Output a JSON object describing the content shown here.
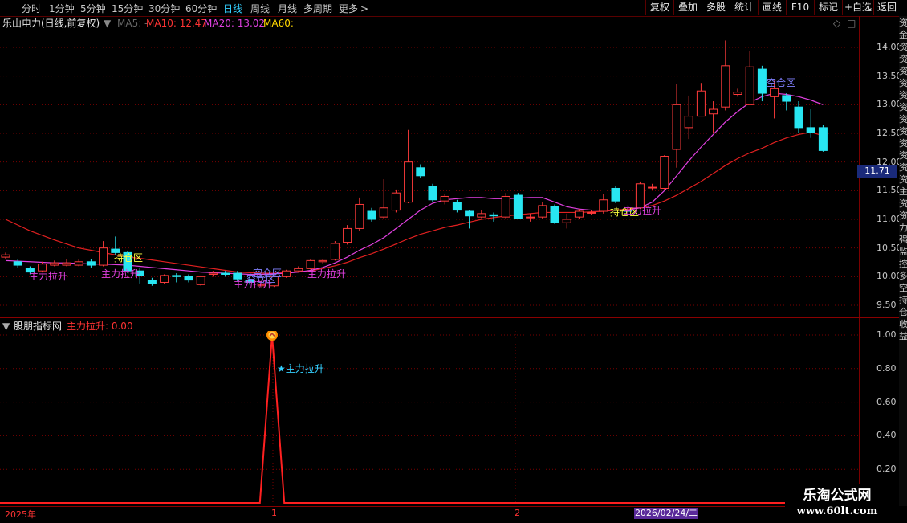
{
  "toolbar": {
    "periods": [
      "分时",
      "1分钟",
      "5分钟",
      "15分钟",
      "30分钟",
      "60分钟",
      "日线",
      "周线",
      "月线",
      "多周期",
      "更多"
    ],
    "active_period": "日线",
    "more_arrow": ">",
    "right_buttons": [
      "复权",
      "叠加",
      "多股",
      "统计",
      "画线",
      "F10",
      "标记",
      "+自选",
      "返回"
    ]
  },
  "main_info": {
    "stock_label": "乐山电力(日线,前复权)",
    "ma5": "MA5: -",
    "ma10": "MA10: 12.47",
    "ma20": "MA20: 13.02",
    "ma60": "MA60:"
  },
  "sub_info": {
    "title": "股朋指标网",
    "value": "主力拉升: 0.00"
  },
  "colors": {
    "up": "#ff3b3b",
    "down": "#28e6f2",
    "ma_red": "#e02020",
    "ma_purple": "#e040e0",
    "label_purple": "#e040e0",
    "label_blue": "#8080ff",
    "label_yellow": "#ffff40",
    "axis_text": "#c8c8c8",
    "grid": "#7a0000"
  },
  "price_axis": {
    "ticks": [
      "14.00",
      "13.50",
      "13.00",
      "12.50",
      "12.00",
      "11.50",
      "11.00",
      "10.50",
      "10.00",
      "9.50"
    ],
    "current_price": "11.71"
  },
  "sub_axis": {
    "ticks": [
      "1.00",
      "0.80",
      "0.60",
      "0.40",
      "0.20"
    ]
  },
  "time_axis": {
    "labels": [
      "2025年",
      "1",
      "2"
    ],
    "cursor_date": "2026/02/24/二"
  },
  "chart_data": [
    {
      "type": "candlestick",
      "title": "乐山电力(日线,前复权)",
      "ylim": [
        9.3,
        14.3
      ],
      "candles": [
        {
          "o": 10.34,
          "c": 10.38,
          "h": 10.42,
          "l": 10.3
        },
        {
          "o": 10.26,
          "c": 10.2,
          "h": 10.3,
          "l": 10.16
        },
        {
          "o": 10.14,
          "c": 10.08,
          "h": 10.18,
          "l": 10.04
        },
        {
          "o": 10.1,
          "c": 10.22,
          "h": 10.26,
          "l": 10.08
        },
        {
          "o": 10.2,
          "c": 10.24,
          "h": 10.28,
          "l": 10.18
        },
        {
          "o": 10.2,
          "c": 10.24,
          "h": 10.3,
          "l": 10.18
        },
        {
          "o": 10.2,
          "c": 10.26,
          "h": 10.3,
          "l": 10.18
        },
        {
          "o": 10.26,
          "c": 10.2,
          "h": 10.3,
          "l": 10.16
        },
        {
          "o": 10.2,
          "c": 10.5,
          "h": 10.62,
          "l": 10.18
        },
        {
          "o": 10.48,
          "c": 10.42,
          "h": 10.7,
          "l": 10.38
        },
        {
          "o": 10.42,
          "c": 10.1,
          "h": 10.45,
          "l": 10.06
        },
        {
          "o": 10.1,
          "c": 10.02,
          "h": 10.16,
          "l": 9.88
        },
        {
          "o": 9.94,
          "c": 9.88,
          "h": 9.98,
          "l": 9.84
        },
        {
          "o": 9.9,
          "c": 10.02,
          "h": 10.04,
          "l": 9.88
        },
        {
          "o": 10.02,
          "c": 10.0,
          "h": 10.06,
          "l": 9.9
        },
        {
          "o": 10.0,
          "c": 9.94,
          "h": 10.04,
          "l": 9.9
        },
        {
          "o": 9.86,
          "c": 10.0,
          "h": 10.02,
          "l": 9.84
        },
        {
          "o": 10.04,
          "c": 10.06,
          "h": 10.1,
          "l": 10.0
        },
        {
          "o": 10.06,
          "c": 10.04,
          "h": 10.1,
          "l": 10.0
        },
        {
          "o": 10.06,
          "c": 9.96,
          "h": 10.1,
          "l": 9.92
        },
        {
          "o": 9.94,
          "c": 9.9,
          "h": 10.0,
          "l": 9.86
        },
        {
          "o": 9.84,
          "c": 9.86,
          "h": 9.94,
          "l": 9.8
        },
        {
          "o": 9.84,
          "c": 10.0,
          "h": 10.02,
          "l": 9.82
        },
        {
          "o": 10.0,
          "c": 10.1,
          "h": 10.12,
          "l": 9.98
        },
        {
          "o": 10.1,
          "c": 10.14,
          "h": 10.18,
          "l": 10.08
        },
        {
          "o": 10.14,
          "c": 10.28,
          "h": 10.3,
          "l": 10.12
        },
        {
          "o": 10.26,
          "c": 10.28,
          "h": 10.3,
          "l": 10.22
        },
        {
          "o": 10.3,
          "c": 10.58,
          "h": 10.62,
          "l": 10.28
        },
        {
          "o": 10.6,
          "c": 10.84,
          "h": 10.9,
          "l": 10.56
        },
        {
          "o": 10.84,
          "c": 11.26,
          "h": 11.38,
          "l": 10.8
        },
        {
          "o": 11.14,
          "c": 11.0,
          "h": 11.2,
          "l": 10.96
        },
        {
          "o": 11.04,
          "c": 11.2,
          "h": 11.7,
          "l": 11.0
        },
        {
          "o": 11.16,
          "c": 11.46,
          "h": 11.52,
          "l": 11.12
        },
        {
          "o": 11.3,
          "c": 12.0,
          "h": 12.56,
          "l": 11.28
        },
        {
          "o": 11.9,
          "c": 11.76,
          "h": 11.96,
          "l": 11.72
        },
        {
          "o": 11.58,
          "c": 11.34,
          "h": 11.62,
          "l": 11.3
        },
        {
          "o": 11.32,
          "c": 11.4,
          "h": 11.44,
          "l": 11.26
        },
        {
          "o": 11.3,
          "c": 11.16,
          "h": 11.34,
          "l": 11.12
        },
        {
          "o": 11.14,
          "c": 11.06,
          "h": 11.16,
          "l": 10.84
        },
        {
          "o": 11.04,
          "c": 11.1,
          "h": 11.16,
          "l": 11.02
        },
        {
          "o": 11.08,
          "c": 11.06,
          "h": 11.12,
          "l": 10.96
        },
        {
          "o": 11.04,
          "c": 11.4,
          "h": 11.46,
          "l": 11.0
        },
        {
          "o": 11.42,
          "c": 11.02,
          "h": 11.46,
          "l": 11.0
        },
        {
          "o": 11.04,
          "c": 11.04,
          "h": 11.1,
          "l": 10.96
        },
        {
          "o": 11.04,
          "c": 11.24,
          "h": 11.3,
          "l": 11.0
        },
        {
          "o": 11.22,
          "c": 10.94,
          "h": 11.26,
          "l": 10.92
        },
        {
          "o": 10.94,
          "c": 11.0,
          "h": 11.1,
          "l": 10.84
        },
        {
          "o": 11.04,
          "c": 11.14,
          "h": 11.18,
          "l": 11.0
        },
        {
          "o": 11.12,
          "c": 11.12,
          "h": 11.16,
          "l": 11.08
        },
        {
          "o": 11.14,
          "c": 11.34,
          "h": 11.44,
          "l": 11.1
        },
        {
          "o": 11.54,
          "c": 11.32,
          "h": 11.58,
          "l": 11.28
        },
        {
          "o": 11.16,
          "c": 11.14,
          "h": 11.18,
          "l": 11.1
        },
        {
          "o": 11.2,
          "c": 11.62,
          "h": 11.66,
          "l": 11.18
        },
        {
          "o": 11.56,
          "c": 11.56,
          "h": 11.62,
          "l": 11.52
        },
        {
          "o": 11.54,
          "c": 12.1,
          "h": 12.12,
          "l": 11.52
        },
        {
          "o": 12.22,
          "c": 13.0,
          "h": 13.36,
          "l": 11.9
        },
        {
          "o": 12.6,
          "c": 12.8,
          "h": 13.16,
          "l": 12.4
        },
        {
          "o": 12.8,
          "c": 13.24,
          "h": 13.38,
          "l": 12.82
        },
        {
          "o": 12.84,
          "c": 12.92,
          "h": 13.06,
          "l": 12.5
        },
        {
          "o": 12.96,
          "c": 13.68,
          "h": 14.12,
          "l": 12.9
        },
        {
          "o": 13.18,
          "c": 13.22,
          "h": 13.28,
          "l": 13.14
        },
        {
          "o": 13.0,
          "c": 13.66,
          "h": 13.94,
          "l": 13.0
        },
        {
          "o": 13.62,
          "c": 13.2,
          "h": 13.68,
          "l": 13.06
        },
        {
          "o": 13.14,
          "c": 13.28,
          "h": 13.42,
          "l": 12.76
        },
        {
          "o": 13.16,
          "c": 13.06,
          "h": 13.2,
          "l": 12.9
        },
        {
          "o": 12.96,
          "c": 12.6,
          "h": 13.06,
          "l": 12.5
        },
        {
          "o": 12.6,
          "c": 12.52,
          "h": 12.92,
          "l": 12.42
        },
        {
          "o": 12.6,
          "c": 12.2,
          "h": 12.64,
          "l": 12.18
        }
      ],
      "ma10": [
        10.28,
        10.27,
        10.26,
        10.25,
        10.24,
        10.24,
        10.23,
        10.22,
        10.22,
        10.21,
        10.2,
        10.18,
        10.16,
        10.14,
        10.12,
        10.1,
        10.08,
        10.07,
        10.06,
        10.05,
        10.04,
        10.04,
        10.05,
        10.06,
        10.08,
        10.11,
        10.16,
        10.24,
        10.34,
        10.46,
        10.56,
        10.68,
        10.84,
        11.0,
        11.16,
        11.28,
        11.34,
        11.36,
        11.38,
        11.38,
        11.36,
        11.36,
        11.37,
        11.38,
        11.38,
        11.3,
        11.22,
        11.18,
        11.16,
        11.16,
        11.16,
        11.16,
        11.2,
        11.3,
        11.5,
        11.76,
        12.02,
        12.26,
        12.48,
        12.7,
        12.88,
        13.04,
        13.14,
        13.2,
        13.18,
        13.14,
        13.08,
        13.0
      ],
      "ma20": [
        11.0,
        10.9,
        10.8,
        10.72,
        10.64,
        10.57,
        10.5,
        10.46,
        10.42,
        10.38,
        10.34,
        10.32,
        10.29,
        10.26,
        10.23,
        10.2,
        10.17,
        10.14,
        10.11,
        10.08,
        10.07,
        10.06,
        10.06,
        10.07,
        10.08,
        10.1,
        10.14,
        10.19,
        10.25,
        10.33,
        10.4,
        10.48,
        10.57,
        10.66,
        10.74,
        10.8,
        10.86,
        10.9,
        10.95,
        11.0,
        11.03,
        11.06,
        11.08,
        11.1,
        11.12,
        11.12,
        11.12,
        11.12,
        11.13,
        11.14,
        11.16,
        11.18,
        11.2,
        11.24,
        11.32,
        11.42,
        11.54,
        11.66,
        11.8,
        11.94,
        12.06,
        12.16,
        12.24,
        12.34,
        12.42,
        12.48,
        12.52,
        12.46
      ],
      "annotations": [
        "主力拉升",
        "主力拉升",
        "持仓区",
        "空仓区",
        "主力拉升",
        "主力拉升",
        "空仓区",
        "持仓区",
        "主力拉升",
        "空仓区"
      ]
    },
    {
      "type": "line",
      "title": "股朋指标网",
      "series": [
        {
          "name": "主力拉升",
          "spike_index": 22,
          "values": [
            0,
            0,
            0,
            0,
            0,
            0,
            0,
            0,
            0,
            0,
            0,
            0,
            0,
            0,
            0,
            0,
            0,
            0,
            0,
            0,
            0,
            0,
            1,
            0,
            0,
            0,
            0,
            0,
            0,
            0,
            0,
            0,
            0,
            0,
            0,
            0,
            0,
            0,
            0,
            0,
            0,
            0,
            0,
            0,
            0,
            0,
            0,
            0,
            0,
            0,
            0,
            0,
            0,
            0,
            0,
            0,
            0,
            0,
            0,
            0,
            0,
            0,
            0,
            0,
            0,
            0,
            0,
            0
          ]
        }
      ],
      "ylim": [
        0,
        1
      ],
      "signal_label": "★主力拉升"
    }
  ],
  "watermark": {
    "line1": "乐淘公式网",
    "line2": "www.60lt.com"
  },
  "side_strip_text": [
    "资",
    "金",
    "资",
    "资",
    "资",
    "资",
    "资",
    "资",
    "资",
    "资",
    "资",
    "资",
    "资",
    "资",
    "主",
    "资",
    "资",
    "力",
    "强",
    "监",
    "控",
    "多",
    "空",
    "持",
    "仓",
    "收",
    "益"
  ]
}
